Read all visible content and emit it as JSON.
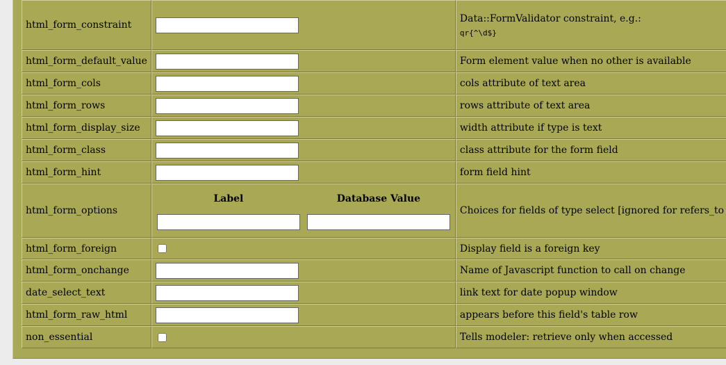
{
  "rows": [
    {
      "id": "constraint",
      "label": "html_form_constraint",
      "desc": "Data::FormValidator constraint, e.g.:",
      "desc_code": "qr{^\\d$}"
    },
    {
      "id": "default-value",
      "label": "html_form_default_value",
      "desc": "Form element value when no other is available"
    },
    {
      "id": "cols",
      "label": "html_form_cols",
      "desc": "cols attribute of text area"
    },
    {
      "id": "rows",
      "label": "html_form_rows",
      "desc": "rows attribute of text area"
    },
    {
      "id": "display-size",
      "label": "html_form_display_size",
      "desc": "width attribute if type is text"
    },
    {
      "id": "class",
      "label": "html_form_class",
      "desc": "class attribute for the form field"
    },
    {
      "id": "hint",
      "label": "html_form_hint",
      "desc": "form field hint"
    },
    {
      "id": "options",
      "label": "html_form_options",
      "desc": "Choices for fields of type select [ignored for refers_to fields]",
      "col_label": "Label",
      "col_db_value": "Database Value"
    },
    {
      "id": "foreign",
      "label": "html_form_foreign",
      "desc": "Display field is a foreign key"
    },
    {
      "id": "onchange",
      "label": "html_form_onchange",
      "desc": "Name of Javascript function to call on change"
    },
    {
      "id": "date-select-text",
      "label": "date_select_text",
      "desc": "link text for date popup window"
    },
    {
      "id": "raw-html",
      "label": "html_form_raw_html",
      "desc": "appears before this field's table row"
    },
    {
      "id": "non-essential",
      "label": "non_essential",
      "desc": "Tells modeler: retrieve only when accessed"
    }
  ]
}
